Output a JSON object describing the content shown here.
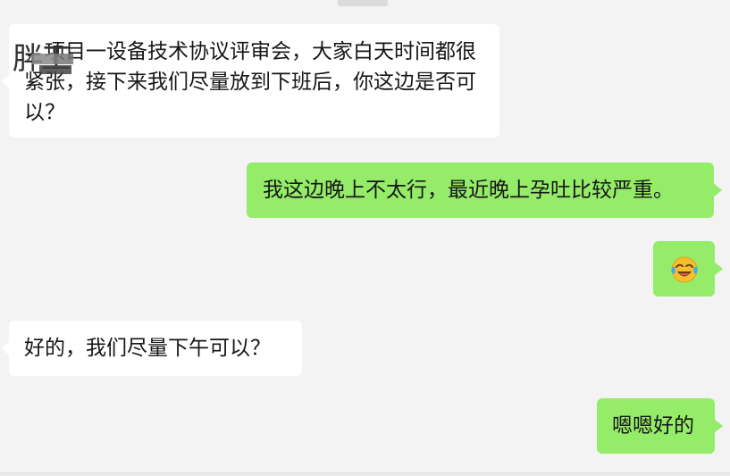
{
  "messages": [
    {
      "direction": "incoming",
      "redacted_prefix": "胖工",
      "text": "，项目一设备技术协议评审会，大家白天时间都很紧张，接下来我们尽量放到下班后，你这边是否可以？"
    },
    {
      "direction": "outgoing",
      "text": "我这边晚上不太行，最近晚上孕吐比较严重。"
    },
    {
      "direction": "outgoing",
      "emoji": "crying-laughing-emoji"
    },
    {
      "direction": "incoming",
      "text": "好的，我们尽量下午可以？"
    },
    {
      "direction": "outgoing",
      "text": "嗯嗯好的"
    }
  ],
  "colors": {
    "background": "#f3f3f3",
    "incoming_bubble": "#ffffff",
    "outgoing_bubble": "#95ec69",
    "text": "#161616"
  }
}
